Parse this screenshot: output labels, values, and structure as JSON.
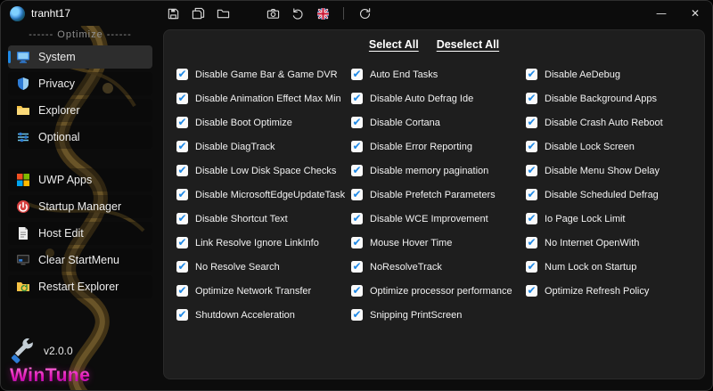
{
  "window": {
    "minimize": "—",
    "close": "✕"
  },
  "titlebar": {
    "username": "tranht17",
    "icons": [
      {
        "name": "save-icon"
      },
      {
        "name": "save-all-icon"
      },
      {
        "name": "folder-open-icon"
      },
      {
        "name": "camera-icon"
      },
      {
        "name": "undo-icon"
      },
      {
        "name": "uk-flag-icon"
      },
      {
        "name": "separator"
      },
      {
        "name": "refresh-icon"
      }
    ]
  },
  "sidebar": {
    "section_label": "------ Optimize ------",
    "groups": [
      [
        {
          "label": "System",
          "icon": "monitor-icon",
          "active": true
        },
        {
          "label": "Privacy",
          "icon": "shield-icon",
          "active": false
        },
        {
          "label": "Explorer",
          "icon": "folder-icon",
          "active": false
        },
        {
          "label": "Optional",
          "icon": "options-icon",
          "active": false
        }
      ],
      [
        {
          "label": "UWP Apps",
          "icon": "apps-icon",
          "active": false
        },
        {
          "label": "Startup Manager",
          "icon": "startup-icon",
          "active": false
        },
        {
          "label": "Host Edit",
          "icon": "document-icon",
          "active": false
        },
        {
          "label": "Clear StartMenu",
          "icon": "startmenu-icon",
          "active": false
        },
        {
          "label": "Restart Explorer",
          "icon": "restart-folder-icon",
          "active": false
        }
      ]
    ],
    "version": "v2.0.0",
    "brand": "WinTune"
  },
  "main": {
    "select_all": "Select All",
    "deselect_all": "Deselect All",
    "check_glyph": "✔",
    "accent_color": "#1e88e5",
    "checked": true,
    "columns": [
      [
        "Disable Game Bar & Game DVR",
        "Disable Animation Effect Max Min",
        "Disable Boot Optimize",
        "Disable DiagTrack",
        "Disable Low Disk Space Checks",
        "Disable MicrosoftEdgeUpdateTask",
        "Disable Shortcut Text",
        "Link Resolve Ignore LinkInfo",
        "No Resolve Search",
        "Optimize Network Transfer",
        "Shutdown Acceleration"
      ],
      [
        "Auto End Tasks",
        "Disable Auto Defrag Ide",
        "Disable Cortana",
        "Disable Error Reporting",
        "Disable memory pagination",
        "Disable Prefetch Parameters",
        "Disable WCE Improvement",
        "Mouse Hover Time",
        "NoResolveTrack",
        "Optimize processor performance",
        "Snipping PrintScreen"
      ],
      [
        "Disable AeDebug",
        "Disable Background Apps",
        "Disable Crash Auto Reboot",
        "Disable Lock Screen",
        "Disable Menu Show Delay",
        "Disable Scheduled Defrag",
        "Io Page Lock Limit",
        "No Internet OpenWith",
        "Num Lock on Startup",
        "Optimize Refresh Policy"
      ]
    ]
  }
}
